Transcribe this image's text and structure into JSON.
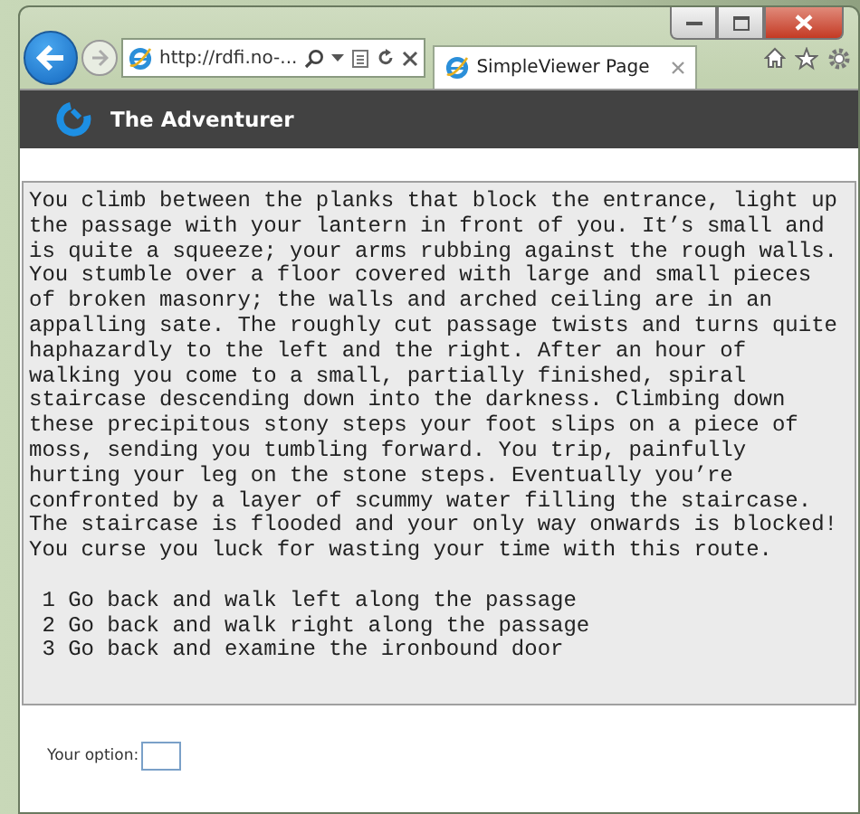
{
  "browser": {
    "address": "http://rdfi.no-...",
    "tabs": [
      {
        "label": "SimpleViewer Page",
        "selected": true
      }
    ]
  },
  "header": {
    "title": "The Adventurer"
  },
  "story": {
    "text": "You climb between the planks that block the entrance, light up the passage with your lantern in front of you. It’s small and is quite a squeeze; your arms rubbing against the rough walls. You stumble over a floor covered with large and small pieces of broken masonry; the walls and arched ceiling are in an appalling sate. The roughly cut passage twists and turns quite haphazardly to the left and the right. After an hour of walking you come to a small, partially finished, spiral staircase descending down into the darkness. Climbing down these precipitous stony steps your foot slips on a piece of moss, sending you tumbling forward. You trip, painfully hurting your leg on the stone steps. Eventually you’re confronted by a layer of scummy water filling the staircase. The staircase is flooded and your only way onwards is blocked! You curse you luck for wasting your time with this route.",
    "options": [
      {
        "number": "1",
        "text": "Go back and walk left along the passage"
      },
      {
        "number": "2",
        "text": "Go back and walk right along the passage"
      },
      {
        "number": "3",
        "text": "Go back and examine the ironbound door"
      }
    ]
  },
  "option_field": {
    "label": "Your option:"
  }
}
